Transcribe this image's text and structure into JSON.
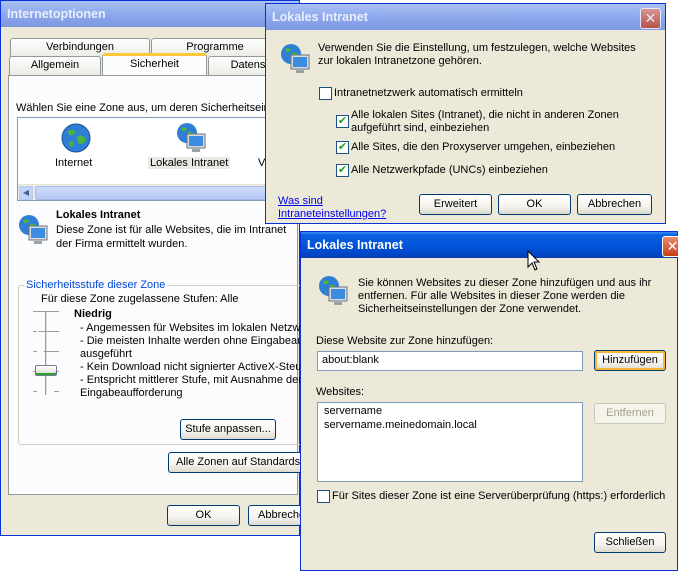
{
  "internet_options": {
    "title": "Internetoptionen",
    "tabs_row1": [
      "Verbindungen",
      "Programme"
    ],
    "tabs_row2": [
      "Allgemein",
      "Sicherheit",
      "Datens"
    ],
    "zone_prompt": "Wählen Sie eine Zone aus, um deren Sicherheitseins",
    "zones": [
      "Internet",
      "Lokales Intranet",
      "V"
    ],
    "zone_title": "Lokales Intranet",
    "zone_desc_1": "Diese Zone ist für alle Websites, die im Intranet",
    "zone_desc_2": "der Firma ermittelt wurden.",
    "level_group": "Sicherheitsstufe dieser Zone",
    "allowed_levels": "Für diese Zone zugelassene Stufen: Alle",
    "level_name": "Niedrig",
    "level_lines": [
      "- Angemessen für Websites im lokalen Netzwe",
      "- Die meisten Inhalte werden ohne Eingabeau",
      "ausgeführt",
      "- Kein Download nicht signierter ActiveX-Steue",
      "- Entspricht mittlerer Stufe, mit Ausnahme der",
      "Eingabeaufforderung"
    ],
    "btn_customize": "Stufe anpassen...",
    "btn_reset_all": "Alle Zonen auf Standardst",
    "btn_ok": "OK",
    "btn_cancel": "Abbreche"
  },
  "intranet_dialog": {
    "title": "Lokales Intranet",
    "intro_1": "Verwenden Sie die Einstellung, um festzulegen, welche Websites",
    "intro_2": "zur lokalen Intranetzone gehören.",
    "opt_auto": "Intranetnetzwerk automatisch ermitteln",
    "opt_local_1": "Alle lokalen Sites (Intranet), die nicht in anderen Zonen",
    "opt_local_2": "aufgeführt sind, einbeziehen",
    "opt_proxy": "Alle Sites, die den Proxyserver umgehen, einbeziehen",
    "opt_unc": "Alle Netzwerkpfade (UNCs) einbeziehen",
    "checks": {
      "auto": false,
      "local": true,
      "proxy": true,
      "unc": true
    },
    "link_1": "Was sind",
    "link_2": "Intraneteinstellungen?",
    "btn_advanced": "Erweitert",
    "btn_ok": "OK",
    "btn_cancel": "Abbrechen"
  },
  "sites_dialog": {
    "title": "Lokales Intranet",
    "intro_1": "Sie können Websites zu dieser Zone hinzufügen und aus ihr",
    "intro_2": "entfernen. Für alle Websites in dieser Zone werden die",
    "intro_3": "Sicherheitseinstellungen der Zone verwendet.",
    "add_label": "Diese Website zur Zone hinzufügen:",
    "add_value": "about:blank",
    "btn_add": "Hinzufügen",
    "list_label": "Websites:",
    "websites": [
      "servername",
      "servername.meinedomain.local"
    ],
    "btn_remove": "Entfernen",
    "https_label": "Für Sites dieser Zone ist eine Serverüberprüfung (https:) erforderlich",
    "https_checked": false,
    "btn_close": "Schließen"
  }
}
